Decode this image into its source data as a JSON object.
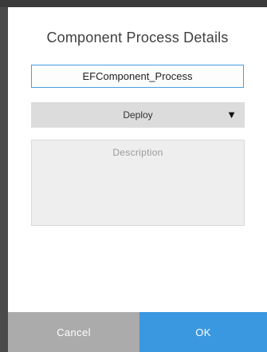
{
  "dialog": {
    "title": "Component Process Details",
    "name_value": "EFComponent_Process",
    "process_type": {
      "selected": "Deploy",
      "arrow_icon": "triangle-down-icon"
    },
    "description_placeholder": "Description",
    "cancel_label": "Cancel",
    "ok_label": "OK"
  },
  "colors": {
    "accent": "#3a98e0",
    "cancel": "#ababab",
    "top_bar": "#3a3a3a"
  }
}
